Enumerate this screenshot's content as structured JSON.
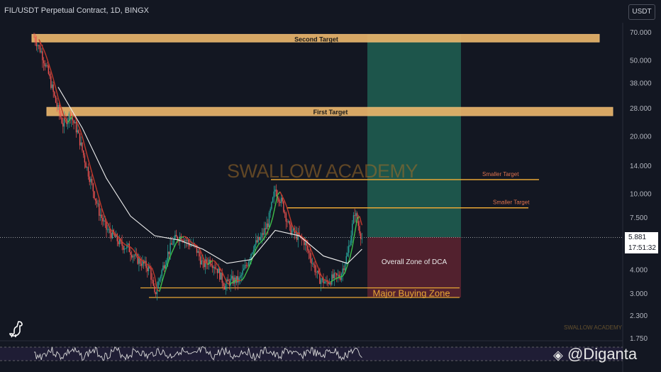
{
  "header": {
    "title": "FIL/USDT Perpetual Contract, 1D, BINGX"
  },
  "currency_button": "USDT",
  "watermark": "SWALLOW ACADEMY",
  "watermark_small": "SWALLOW ACADEMY",
  "price_label": {
    "price": "5.881",
    "countdown": "17:51:32"
  },
  "branding": "@Diganta",
  "colors": {
    "background": "#131722",
    "target_band": "#e8b46a",
    "profit_zone": "#1f5c50",
    "loss_zone": "#5a2230",
    "buy_line": "#e8a634",
    "smaller_target_text": "#e0724d",
    "ema_white": "#f0f0f0",
    "ema_red": "#c0392b",
    "ema_green": "#3fbf4a"
  },
  "chart_data": {
    "type": "candlestick",
    "title": "FIL/USDT Perpetual Contract, 1D, BINGX",
    "scale": "log",
    "y_ticks": [
      "70.000",
      "50.000",
      "38.000",
      "28.000",
      "20.000",
      "14.000",
      "10.000",
      "7.500",
      "5.881",
      "4.000",
      "3.000",
      "2.300",
      "1.750"
    ],
    "y_tick_values": [
      70,
      50,
      38,
      28,
      20,
      14,
      10,
      7.5,
      4,
      3,
      2.3,
      1.75
    ],
    "current_price": 5.881,
    "annotations": [
      {
        "label": "Second Target",
        "type": "zone",
        "price_low": 62,
        "price_high": 68
      },
      {
        "label": "First Target",
        "type": "zone",
        "price_low": 25.5,
        "price_high": 28.2
      },
      {
        "label": "Smaller Target",
        "type": "line",
        "price": 11.8
      },
      {
        "label": "Smaller Target",
        "type": "line",
        "price": 8.4
      },
      {
        "label": "Overall Zone of DCA",
        "type": "zone",
        "price_low": 2.85,
        "price_high": 5.9
      },
      {
        "label": "Major Buying Zone",
        "type": "line",
        "price": 3.2
      },
      {
        "label": "",
        "type": "line",
        "price": 2.85
      }
    ],
    "price_path": [
      [
        0,
        66
      ],
      [
        3,
        55
      ],
      [
        6,
        42
      ],
      [
        9,
        30
      ],
      [
        12,
        23
      ],
      [
        15,
        26
      ],
      [
        18,
        21
      ],
      [
        21,
        15
      ],
      [
        24,
        11
      ],
      [
        27,
        8
      ],
      [
        30,
        6.5
      ],
      [
        33,
        6
      ],
      [
        36,
        5.4
      ],
      [
        39,
        5.2
      ],
      [
        42,
        4.6
      ],
      [
        45,
        4.3
      ],
      [
        48,
        4.0
      ],
      [
        50,
        2.9
      ],
      [
        52,
        3.6
      ],
      [
        55,
        4.7
      ],
      [
        58,
        5.7
      ],
      [
        61,
        6.0
      ],
      [
        64,
        5.5
      ],
      [
        67,
        5.2
      ],
      [
        70,
        4.2
      ],
      [
        73,
        4.5
      ],
      [
        76,
        4.0
      ],
      [
        79,
        3.3
      ],
      [
        82,
        3.5
      ],
      [
        85,
        3.5
      ],
      [
        88,
        4.2
      ],
      [
        91,
        5.3
      ],
      [
        94,
        5.8
      ],
      [
        97,
        7.0
      ],
      [
        100,
        10.5
      ],
      [
        103,
        8.8
      ],
      [
        106,
        6.5
      ],
      [
        109,
        6.0
      ],
      [
        112,
        5.6
      ],
      [
        115,
        4.5
      ],
      [
        118,
        3.6
      ],
      [
        121,
        3.4
      ],
      [
        124,
        3.6
      ],
      [
        127,
        3.7
      ],
      [
        130,
        4.8
      ],
      [
        133,
        8.0
      ],
      [
        136,
        5.8
      ]
    ],
    "ema_slow": [
      [
        10,
        36
      ],
      [
        20,
        22
      ],
      [
        30,
        12
      ],
      [
        40,
        7.6
      ],
      [
        50,
        6.0
      ],
      [
        60,
        5.7
      ],
      [
        70,
        5.1
      ],
      [
        80,
        4.3
      ],
      [
        90,
        4.5
      ],
      [
        100,
        6.4
      ],
      [
        110,
        6.0
      ],
      [
        120,
        4.7
      ],
      [
        130,
        4.3
      ],
      [
        136,
        5.1
      ]
    ]
  }
}
